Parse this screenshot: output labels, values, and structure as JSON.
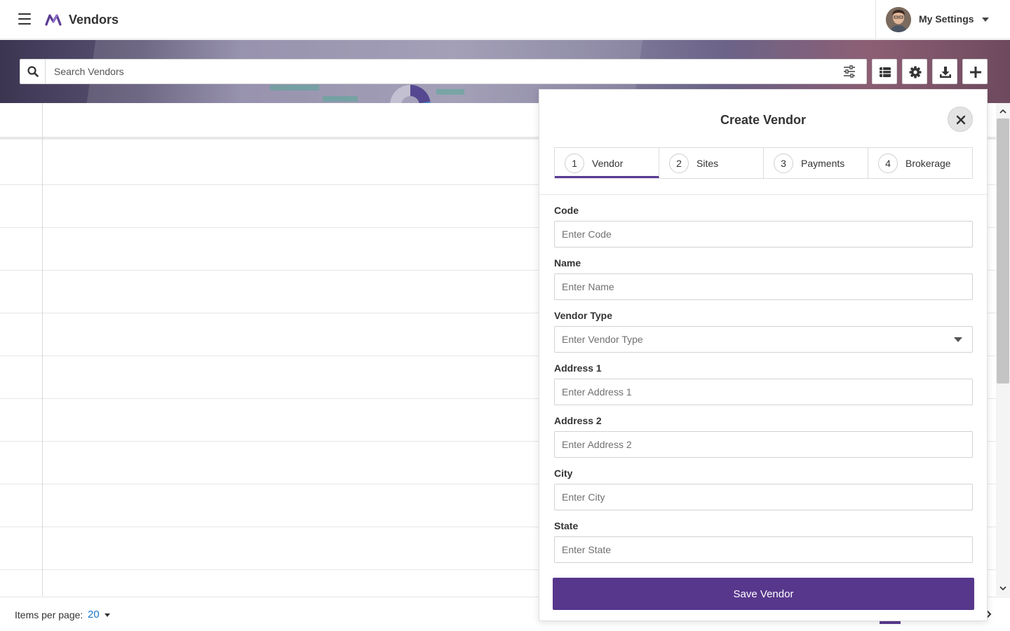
{
  "app": {
    "title": "Vendors",
    "brand_color": "#5a3b93"
  },
  "user_menu": {
    "label": "My Settings"
  },
  "search": {
    "placeholder": "Search Vendors"
  },
  "toolbar": {
    "icons": [
      "search-icon",
      "filter-sliders-icon",
      "list-view-icon",
      "gear-icon",
      "download-icon",
      "plus-icon"
    ]
  },
  "pagination": {
    "items_per_page_label": "Items per page:",
    "items_per_page_value": "20"
  },
  "create_vendor": {
    "title": "Create Vendor",
    "steps": [
      {
        "number": "1",
        "label": "Vendor",
        "active": true
      },
      {
        "number": "2",
        "label": "Sites",
        "active": false
      },
      {
        "number": "3",
        "label": "Payments",
        "active": false
      },
      {
        "number": "4",
        "label": "Brokerage",
        "active": false
      }
    ],
    "fields": {
      "code": {
        "label": "Code",
        "placeholder": "Enter Code",
        "value": ""
      },
      "name": {
        "label": "Name",
        "placeholder": "Enter Name",
        "value": ""
      },
      "vendor_type": {
        "label": "Vendor Type",
        "placeholder": "Enter Vendor Type",
        "value": ""
      },
      "address1": {
        "label": "Address 1",
        "placeholder": "Enter Address 1",
        "value": ""
      },
      "address2": {
        "label": "Address 2",
        "placeholder": "Enter Address 2",
        "value": ""
      },
      "city": {
        "label": "City",
        "placeholder": "Enter City",
        "value": ""
      },
      "state": {
        "label": "State",
        "placeholder": "Enter State",
        "value": ""
      }
    },
    "save_label": "Save Vendor"
  }
}
